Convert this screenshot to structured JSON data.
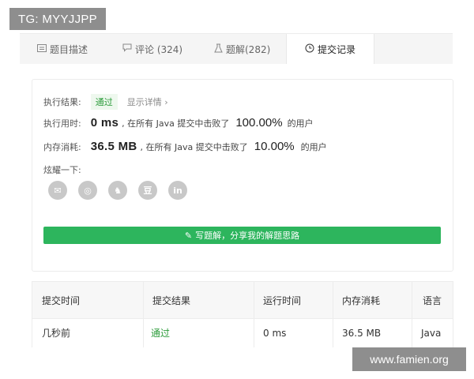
{
  "watermark_top": "TG: MYYJJPP",
  "watermark_bottom": "www.famien.org",
  "tabs": [
    {
      "label": "题目描述",
      "icon": "description-icon"
    },
    {
      "label": "评论 (324)",
      "icon": "comment-icon"
    },
    {
      "label": "题解(282)",
      "icon": "flask-icon"
    },
    {
      "label": "提交记录",
      "icon": "clock-icon"
    }
  ],
  "result": {
    "status_label": "执行结果:",
    "status_value": "通过",
    "details_link": "显示详情 ›",
    "runtime_label": "执行用时:",
    "runtime_value": "0 ms",
    "runtime_beat_text": ", 在所有 Java 提交中击败了",
    "runtime_percent": "100.00%",
    "runtime_suffix": "的用户",
    "memory_label": "内存消耗:",
    "memory_value": "36.5 MB",
    "memory_beat_text": ", 在所有 Java 提交中击败了",
    "memory_percent": "10.00%",
    "memory_suffix": "的用户",
    "share_label": "炫耀一下:",
    "share_icons": [
      "wechat-icon",
      "weibo-icon",
      "qq-icon",
      "douban-icon",
      "linkedin-icon"
    ],
    "share_glyphs": [
      "✉",
      "◎",
      "♞",
      "豆",
      "in"
    ],
    "write_button": "写题解，分享我的解题思路"
  },
  "table": {
    "headers": [
      "提交时间",
      "提交结果",
      "运行时间",
      "内存消耗",
      "语言"
    ],
    "rows": [
      [
        "几秒前",
        "通过",
        "0 ms",
        "36.5 MB",
        "Java"
      ]
    ]
  },
  "colors": {
    "accent": "#2db55d",
    "success_text": "#2b9b3a"
  }
}
